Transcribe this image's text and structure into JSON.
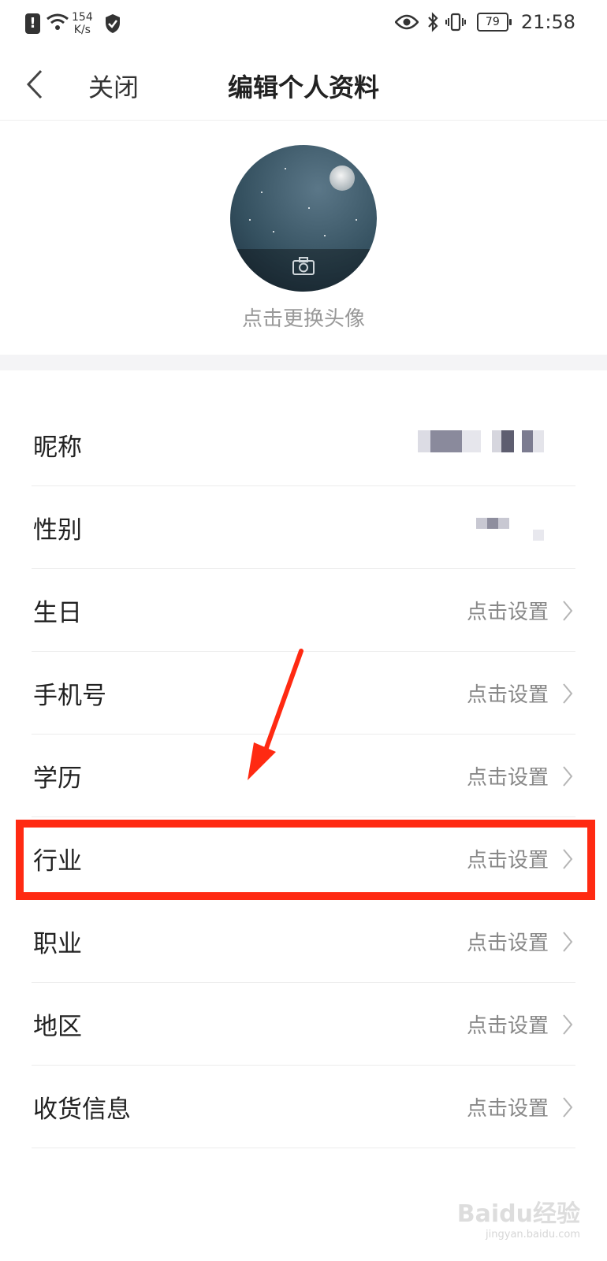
{
  "status_bar": {
    "alert_icon": "alert-icon",
    "network_speed_value": "154",
    "network_speed_unit": "K/s",
    "battery_level": "79",
    "time": "21:58"
  },
  "header": {
    "close_label": "关闭",
    "title": "编辑个人资料"
  },
  "avatar": {
    "caption": "点击更换头像"
  },
  "profile_rows": [
    {
      "label": "昵称"
    },
    {
      "label": "性别"
    },
    {
      "label": "生日",
      "value": "点击设置"
    },
    {
      "label": "手机号",
      "value": "点击设置"
    },
    {
      "label": "学历",
      "value": "点击设置"
    },
    {
      "label": "行业",
      "value": "点击设置"
    },
    {
      "label": "职业",
      "value": "点击设置"
    },
    {
      "label": "地区",
      "value": "点击设置"
    },
    {
      "label": "收货信息",
      "value": "点击设置"
    }
  ],
  "watermark": {
    "brand": "Baidu经验",
    "url": "jingyan.baidu.com"
  },
  "colors": {
    "annotation_red": "#ff2a12",
    "secondary_text": "#888888",
    "section_band": "#f4f4f6"
  }
}
